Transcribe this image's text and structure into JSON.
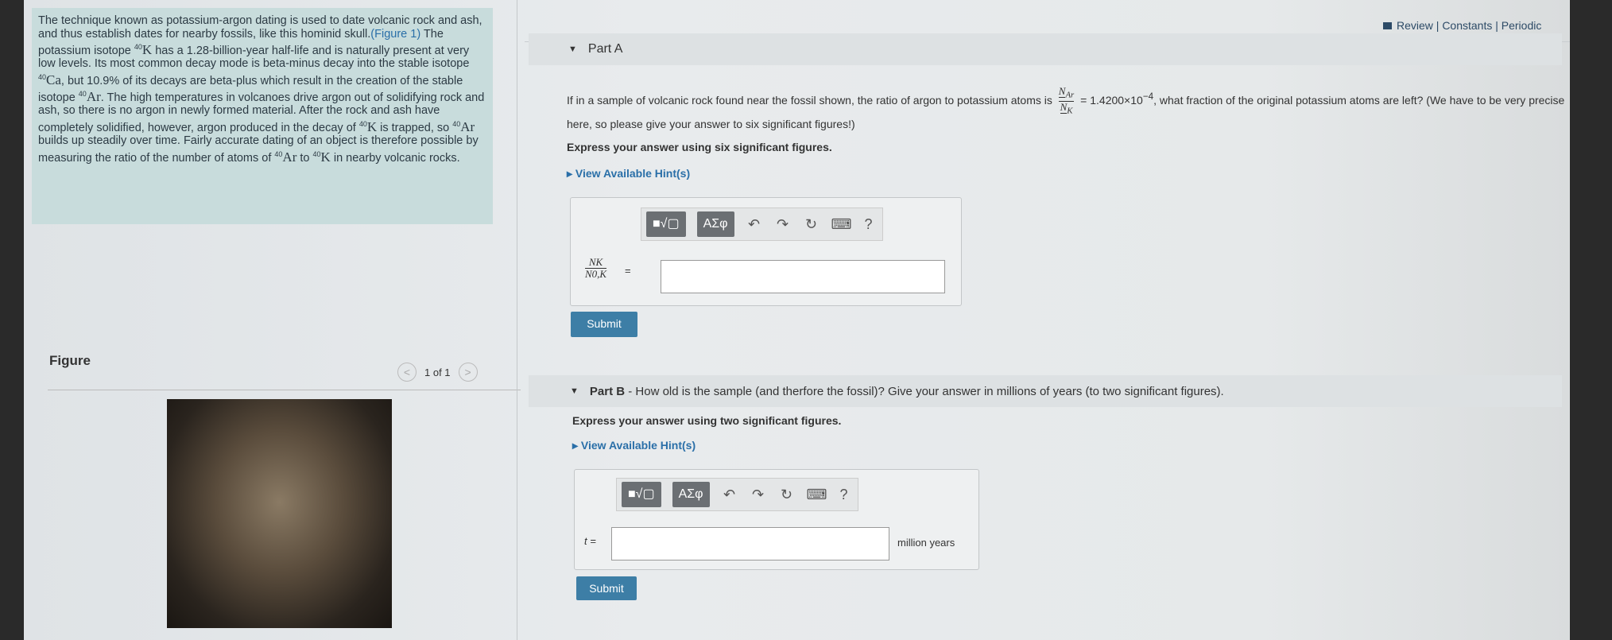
{
  "intro": {
    "p1": "The technique known as potassium-argon dating is used to date volcanic rock and ash, and thus establish dates for nearby fossils, like this hominid skull.",
    "figure_link": "(Figure 1)",
    "p2": " The potassium isotope ",
    "p3": " has a 1.28-billion-year half-life and is naturally present at very low levels. Its most common decay mode is beta-minus decay into the stable isotope ",
    "p4": ", but 10.9% of its decays are beta-plus which result in the creation of the stable isotope ",
    "p5": ". The high temperatures in volcanoes drive argon out of solidifying rock and ash, so there is no argon in newly formed material. After the rock and ash have completely solidified, however, argon produced in the decay of ",
    "p6": " is trapped, so ",
    "p7": " builds up steadily over time. Fairly accurate dating of an object is therefore possible by measuring the ratio of the number of atoms of ",
    "p8": " to ",
    "p9": " in nearby volcanic rocks.",
    "mass": "40",
    "K": "K",
    "Ca": "Ca",
    "Ar": "Ar"
  },
  "figure": {
    "title": "Figure",
    "pager": "1 of 1",
    "prev": "<",
    "next": ">"
  },
  "topnav": "Review | Constants | Periodic Table",
  "partA": {
    "title": "Part A",
    "q1": "If in a sample of volcanic rock found near the fossil shown, the ratio of argon to potassium atoms is",
    "num": "N",
    "num_sub": "Ar",
    "den": "N",
    "den_sub": "K",
    "q2": "= 1.4200×10",
    "exp": "−4",
    "q3": ", what fraction of the original potassium atoms are left? (We have to be very precise here, so please give your answer to six significant figures!)",
    "express": "Express your answer using six significant figures.",
    "hint": "View Available Hint(s)",
    "lhs_num": "NK",
    "lhs_den": "N0,K",
    "eq": "=",
    "value": "",
    "submit": "Submit"
  },
  "partB": {
    "title": "Part B",
    "question": " - How old is the sample (and therfore the fossil)? Give your answer in millions of years (to two significant figures).",
    "express": "Express your answer using two significant figures.",
    "hint": "View Available Hint(s)",
    "lhs": "t =",
    "value": "",
    "unit": "million years",
    "submit": "Submit"
  },
  "toolbar": {
    "templates": "■√▢",
    "greek": "ΑΣφ",
    "undo": "↶",
    "redo": "↷",
    "reset": "↻",
    "keyboard": "⌨",
    "help": "?"
  }
}
